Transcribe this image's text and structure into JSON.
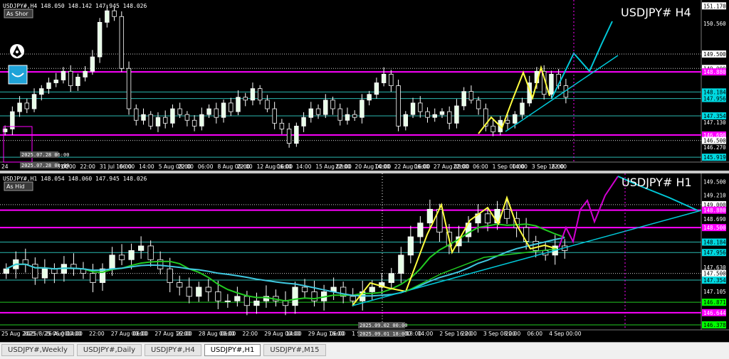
{
  "colors": {
    "magenta": "#ff00ff",
    "cyan": "#00c8d8",
    "teal": "#2ab8b0",
    "yellow": "#ffff40",
    "green": "#22cc22",
    "white": "#ffffff",
    "label_magenta": "#ff00ff",
    "label_cyan": "#00d8e0",
    "label_green": "#00ff00"
  },
  "panel1": {
    "header": "USDJPY#,H4  148.050 148.142 147.945 148.026",
    "symbol": "USDJPY# H4",
    "button": "As Shor",
    "crosshair_date": "2025.07.28 06:00",
    "crosshair_date2": "2025.07.28 00:00",
    "price_labels": [
      {
        "text": "151.170",
        "y": 151.17,
        "color": "#ffffff",
        "text_color": "#000"
      },
      {
        "text": "150.560",
        "y": 150.56,
        "color": null
      },
      {
        "text": "149.500",
        "y": 149.5,
        "color": "#ffffff",
        "text_color": "#000"
      },
      {
        "text": "149.000",
        "y": 149.0,
        "color": "#ffffff",
        "text_color": "#000"
      },
      {
        "text": "148.880",
        "y": 148.88,
        "color": "#ff00ff",
        "text_color": "#fff"
      },
      {
        "text": "148.184",
        "y": 148.184,
        "color": "#00d8e0",
        "text_color": "#000"
      },
      {
        "text": "147.956",
        "y": 147.956,
        "color": "#00d8e0",
        "text_color": "#000"
      },
      {
        "text": "147.354",
        "y": 147.354,
        "color": "#00d8e0",
        "text_color": "#000"
      },
      {
        "text": "147.130",
        "y": 147.13,
        "color": null
      },
      {
        "text": "146.690",
        "y": 146.69,
        "color": "#ff00ff",
        "text_color": "#fff"
      },
      {
        "text": "146.500",
        "y": 146.5,
        "color": "#ffffff",
        "text_color": "#000"
      },
      {
        "text": "146.270",
        "y": 146.27,
        "color": null
      },
      {
        "text": "145.919",
        "y": 145.919,
        "color": "#00d8e0",
        "text_color": "#000"
      }
    ],
    "time_labels": [
      "24",
      "2025.07.28 06:00",
      "06:00",
      "14:00",
      "22:00",
      "31 Jul 16:00",
      "06:00",
      "14:00",
      "5 Aug 08:00",
      "22:00",
      "06:00",
      "8 Aug 00:00",
      "22:00",
      "12 Aug 16:00",
      "06:00",
      "14:00",
      "15 Aug 08:00",
      "22:00",
      "20 Aug 00:00",
      "14:00",
      "22 Aug 16:00",
      "06:00",
      "27 Aug 08:00",
      "22:00",
      "06:00",
      "1 Sep 00:00",
      "14:00",
      "3 Sep 16:00",
      "22:00"
    ]
  },
  "panel2": {
    "header": "USDJPY#,H1  148.054 148.060 147.945 148.026",
    "symbol": "USDJPY# H1",
    "button": "As Hid",
    "crosshair_date": "2025.09.02 00:00",
    "crosshair_date2": "2025.09.01 18:00",
    "price_labels": [
      {
        "text": "149.500",
        "y": 149.5,
        "color": null
      },
      {
        "text": "149.210",
        "y": 149.21,
        "color": null
      },
      {
        "text": "149.000",
        "y": 149.0,
        "color": "#ffffff",
        "text_color": "#000"
      },
      {
        "text": "148.880",
        "y": 148.88,
        "color": "#ff00ff",
        "text_color": "#fff"
      },
      {
        "text": "148.690",
        "y": 148.69,
        "color": null
      },
      {
        "text": "148.500",
        "y": 148.5,
        "color": "#ff00ff",
        "text_color": "#fff"
      },
      {
        "text": "148.184",
        "y": 148.184,
        "color": "#00d8e0",
        "text_color": "#000"
      },
      {
        "text": "147.956",
        "y": 147.956,
        "color": "#00d8e0",
        "text_color": "#000"
      },
      {
        "text": "147.630",
        "y": 147.63,
        "color": null
      },
      {
        "text": "147.500",
        "y": 147.5,
        "color": "#ffffff",
        "text_color": "#000"
      },
      {
        "text": "147.354",
        "y": 147.354,
        "color": "#00d8e0",
        "text_color": "#000"
      },
      {
        "text": "147.105",
        "y": 147.105,
        "color": null
      },
      {
        "text": "146.871",
        "y": 146.871,
        "color": "#00ff00",
        "text_color": "#000"
      },
      {
        "text": "146.644",
        "y": 146.644,
        "color": "#ff00ff",
        "text_color": "#fff"
      },
      {
        "text": "146.378",
        "y": 146.378,
        "color": "#00ff00",
        "text_color": "#000"
      }
    ],
    "time_labels": [
      "25 Aug 2025",
      "2025/8/25 06:00",
      "26 Aug 00:00",
      "14:00",
      "22:00",
      "27 Aug 00:00",
      "06:00",
      "27 Aug 16:00",
      "22:00",
      "28 Aug 00:00",
      "06:00",
      "22:00",
      "29 Aug 00:00",
      "14:00",
      "29 Aug 16:00",
      "06:00",
      "1 Sep",
      "2025.09.01 18:00",
      "06:00",
      "14:00",
      "2 Sep 16:00",
      "22:00",
      "3 Sep 08:00",
      "22:00",
      "06:00",
      "4 Sep 00:00"
    ]
  },
  "tabs": [
    {
      "label": "USDJPY#,Weekly",
      "active": false
    },
    {
      "label": "USDJPY#,Daily",
      "active": false
    },
    {
      "label": "USDJPY#,H4",
      "active": false
    },
    {
      "label": "USDJPY#,H1",
      "active": true
    },
    {
      "label": "USDJPY#,M15",
      "active": false
    }
  ],
  "chart_data": [
    {
      "type": "candlestick",
      "title": "USDJPY# H4",
      "ylim": [
        145.8,
        151.3
      ],
      "horizontal_levels": [
        {
          "value": 148.88,
          "color": "magenta"
        },
        {
          "value": 146.69,
          "color": "magenta"
        },
        {
          "value": 148.184,
          "color": "cyan"
        },
        {
          "value": 147.956,
          "color": "cyan"
        },
        {
          "value": 147.354,
          "color": "cyan"
        },
        {
          "value": 145.919,
          "color": "cyan"
        },
        {
          "value": 149.5,
          "color": "white-dotted"
        },
        {
          "value": 149.0,
          "color": "white-dotted"
        },
        {
          "value": 146.5,
          "color": "white-dotted"
        }
      ],
      "closes": [
        146.9,
        147.5,
        147.8,
        147.6,
        148.1,
        148.3,
        148.5,
        148.6,
        148.9,
        148.4,
        148.7,
        148.9,
        149.4,
        150.6,
        151.0,
        150.8,
        149.0,
        147.6,
        147.2,
        147.4,
        147.0,
        147.3,
        147.1,
        147.6,
        147.4,
        147.2,
        147.0,
        147.4,
        147.6,
        147.3,
        147.8,
        147.5,
        148.0,
        147.9,
        148.3,
        147.9,
        147.6,
        147.1,
        146.9,
        146.4,
        147.0,
        147.3,
        147.6,
        147.4,
        147.9,
        147.6,
        147.2,
        147.4,
        147.3,
        147.9,
        148.1,
        148.5,
        148.8,
        148.4,
        147.0,
        147.4,
        147.8,
        147.5,
        147.3,
        147.4,
        147.5,
        147.1,
        147.7,
        148.2,
        147.9,
        147.6,
        147.0,
        146.8,
        147.2,
        147.1,
        147.4,
        147.8,
        148.5,
        148.9,
        148.1,
        148.8,
        148.4,
        148.0
      ]
    },
    {
      "type": "candlestick",
      "title": "USDJPY# H1",
      "ylim": [
        146.3,
        149.65
      ],
      "horizontal_levels": [
        {
          "value": 148.88,
          "color": "magenta"
        },
        {
          "value": 148.5,
          "color": "magenta"
        },
        {
          "value": 146.644,
          "color": "magenta"
        },
        {
          "value": 147.354,
          "color": "cyan"
        },
        {
          "value": 148.184,
          "color": "cyan"
        },
        {
          "value": 147.956,
          "color": "cyan"
        },
        {
          "value": 146.871,
          "color": "green"
        },
        {
          "value": 146.378,
          "color": "green"
        },
        {
          "value": 149.0,
          "color": "white-dotted"
        },
        {
          "value": 147.5,
          "color": "white-dotted"
        }
      ],
      "closes": [
        147.6,
        147.8,
        147.7,
        147.4,
        147.6,
        147.5,
        147.7,
        147.6,
        147.5,
        147.3,
        147.6,
        147.9,
        147.8,
        148.0,
        148.1,
        147.8,
        147.6,
        147.3,
        147.2,
        147.0,
        147.2,
        147.1,
        146.9,
        146.9,
        147.0,
        146.8,
        146.9,
        147.0,
        146.9,
        146.8,
        147.2,
        147.1,
        146.9,
        147.1,
        147.2,
        147.0,
        146.9,
        147.1,
        147.2,
        147.3,
        147.5,
        147.9,
        148.3,
        148.6,
        148.9,
        148.4,
        148.1,
        148.3,
        148.6,
        148.8,
        148.6,
        148.9,
        148.7,
        148.5,
        148.2,
        148.0,
        147.9,
        148.1,
        148.0
      ]
    }
  ]
}
